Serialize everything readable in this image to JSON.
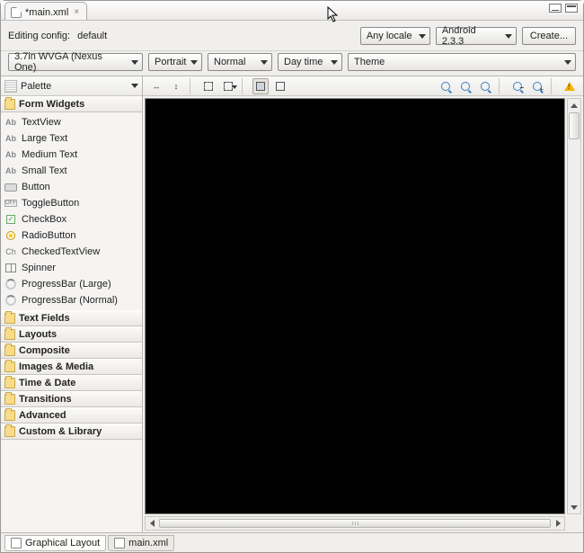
{
  "tab": {
    "title": "*main.xml"
  },
  "config": {
    "editing_label": "Editing config:",
    "current_config": "default",
    "locale": "Any locale",
    "api_version": "Android 2.3.3",
    "create_button": "Create...",
    "device": "3.7in WVGA (Nexus One)",
    "orientation": "Portrait",
    "dock": "Normal",
    "daynight": "Day time",
    "theme": "Theme"
  },
  "palette": {
    "title": "Palette",
    "sections": {
      "form_widgets": "Form Widgets",
      "text_fields": "Text Fields",
      "layouts": "Layouts",
      "composite": "Composite",
      "images_media": "Images & Media",
      "time_date": "Time & Date",
      "transitions": "Transitions",
      "advanced": "Advanced",
      "custom_library": "Custom & Library"
    },
    "form_widgets": {
      "textview": "TextView",
      "large_text": "Large Text",
      "medium_text": "Medium Text",
      "small_text": "Small Text",
      "button": "Button",
      "togglebutton": "ToggleButton",
      "checkbox": "CheckBox",
      "radiobutton": "RadioButton",
      "checkedtextview": "CheckedTextView",
      "spinner": "Spinner",
      "progressbar_large": "ProgressBar (Large)",
      "progressbar_normal": "ProgressBar (Normal)"
    }
  },
  "bottom_tabs": {
    "graphical": "Graphical Layout",
    "xml": "main.xml"
  }
}
